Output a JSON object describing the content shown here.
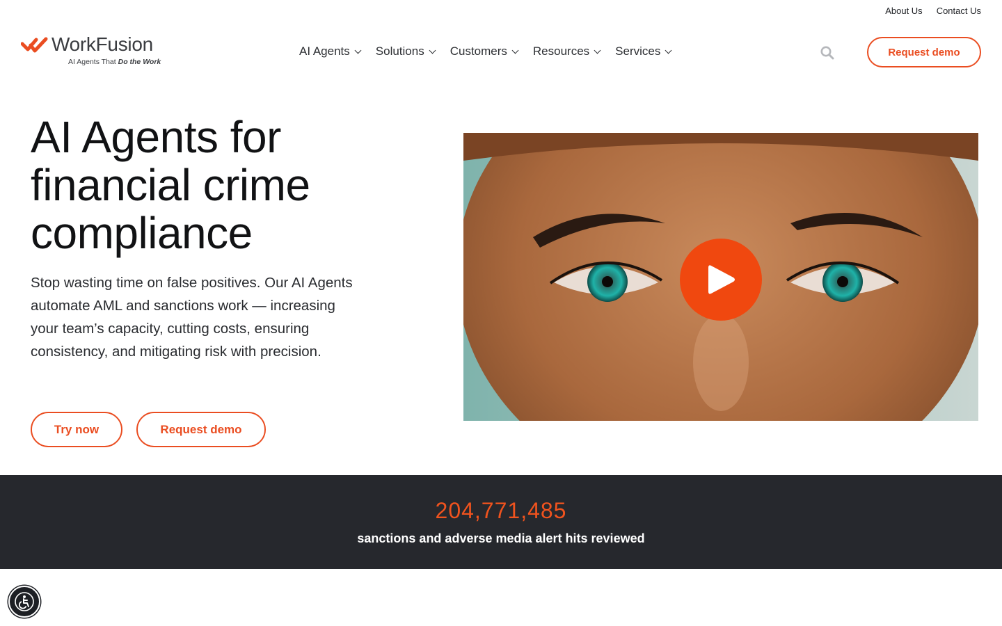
{
  "utility_nav": {
    "about": "About Us",
    "contact": "Contact Us"
  },
  "logo": {
    "word": "WorkFusion",
    "tagline_prefix": "AI Agents That",
    "tagline_emphasis": "Do the Work"
  },
  "nav": [
    {
      "label": "AI Agents"
    },
    {
      "label": "Solutions"
    },
    {
      "label": "Customers"
    },
    {
      "label": "Resources"
    },
    {
      "label": "Services"
    }
  ],
  "header": {
    "cta": "Request demo",
    "search_icon": "search-icon"
  },
  "hero": {
    "title": "AI Agents for financial crime compliance",
    "subtitle": "Stop wasting time on false positives. Our AI Agents automate AML and sanctions work — increasing your team’s capacity, cutting costs, ensuring consistency, and mitigating risk with precision.",
    "primary_cta": "Try now",
    "secondary_cta": "Request demo"
  },
  "video": {
    "play_icon": "play-icon"
  },
  "stats": {
    "number": "204,771,485",
    "label": "sanctions and adverse media alert hits reviewed"
  },
  "accessibility": {
    "icon": "accessibility-icon"
  },
  "colors": {
    "accent": "#ea4d21",
    "dark_band": "#26282d",
    "text": "#111214"
  }
}
